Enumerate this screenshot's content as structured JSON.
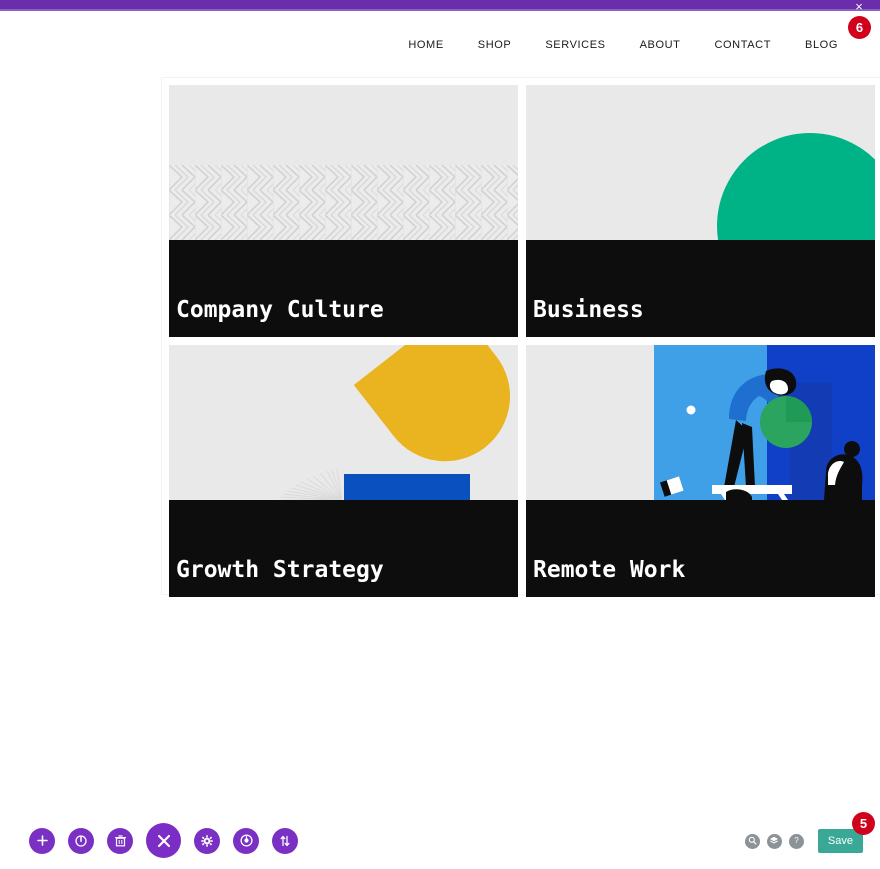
{
  "top_bar": {
    "close_label": "×",
    "badge": "6",
    "bar_color": "#6a2ead",
    "badge_color": "#d0021b"
  },
  "header": {
    "nav": [
      {
        "label": "HOME"
      },
      {
        "label": "SHOP"
      },
      {
        "label": "SERVICES"
      },
      {
        "label": "ABOUT"
      },
      {
        "label": "CONTACT"
      },
      {
        "label": "BLOG"
      }
    ]
  },
  "grid": {
    "cards": [
      {
        "title": "Company Culture",
        "media": "chevron-pattern",
        "accent": "#d6d6d6"
      },
      {
        "title": "Business",
        "media": "green-circle",
        "accent": "#00b387"
      },
      {
        "title": "Growth Strategy",
        "media": "yellow-halfmoon-blue-bar",
        "accent": "#eab320"
      },
      {
        "title": "Remote Work",
        "media": "people-illustration",
        "accent": "#2f9ae8"
      }
    ],
    "band_color": "#0d0d0d",
    "media_bg": "#e9e9e9"
  },
  "toolbar": {
    "left_buttons": [
      {
        "icon": "plus-icon",
        "name": "add-button"
      },
      {
        "icon": "power-icon",
        "name": "power-button"
      },
      {
        "icon": "trash-icon",
        "name": "delete-button"
      },
      {
        "icon": "close-x-icon",
        "name": "close-editor-button"
      },
      {
        "icon": "gear-icon",
        "name": "settings-button"
      },
      {
        "icon": "clock-icon",
        "name": "history-button"
      },
      {
        "icon": "arrows-updown-icon",
        "name": "reorder-button"
      }
    ],
    "right_buttons": [
      {
        "icon": "search-icon",
        "name": "search-button"
      },
      {
        "icon": "layers-icon",
        "name": "layers-button"
      },
      {
        "icon": "question-icon",
        "name": "help-button"
      }
    ],
    "save_label": "Save",
    "save_badge": "5",
    "save_color": "#3aa896",
    "button_color": "#7b30c4"
  }
}
